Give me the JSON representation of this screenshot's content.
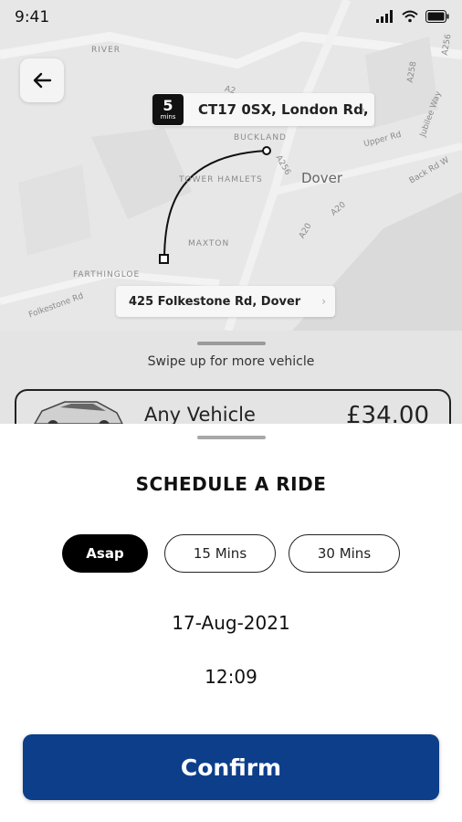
{
  "status_bar": {
    "time": "9:41"
  },
  "map": {
    "labels": [
      "RIVER",
      "BUCKLAND",
      "TOWER HAMLETS",
      "Dover",
      "MAXTON",
      "FARTHINGLOE",
      "Folkestone Rd",
      "A256",
      "A20",
      "A20",
      "Upper Rd",
      "Jubilee Way",
      "Back Rd W",
      "A2",
      "A258",
      "A256"
    ],
    "pickup": {
      "eta_number": "5",
      "eta_unit": "mins",
      "address": "CT17 0SX, London Rd,"
    },
    "dropoff": {
      "address": "425 Folkestone Rd, Dover"
    },
    "chevron": "›"
  },
  "vehicle_panel": {
    "hint": "Swipe up for more vehicle",
    "vehicle_name": "Any Vehicle",
    "price": "£34.00"
  },
  "schedule": {
    "title": "SCHEDULE A RIDE",
    "options": [
      {
        "label": "Asap",
        "selected": true
      },
      {
        "label": "15 Mins",
        "selected": false
      },
      {
        "label": "30 Mins",
        "selected": false
      }
    ],
    "date": "17-Aug-2021",
    "time": "12:09",
    "confirm_label": "Confirm"
  },
  "colors": {
    "confirm": "#0c3e8a",
    "selected_chip": "#000000"
  }
}
